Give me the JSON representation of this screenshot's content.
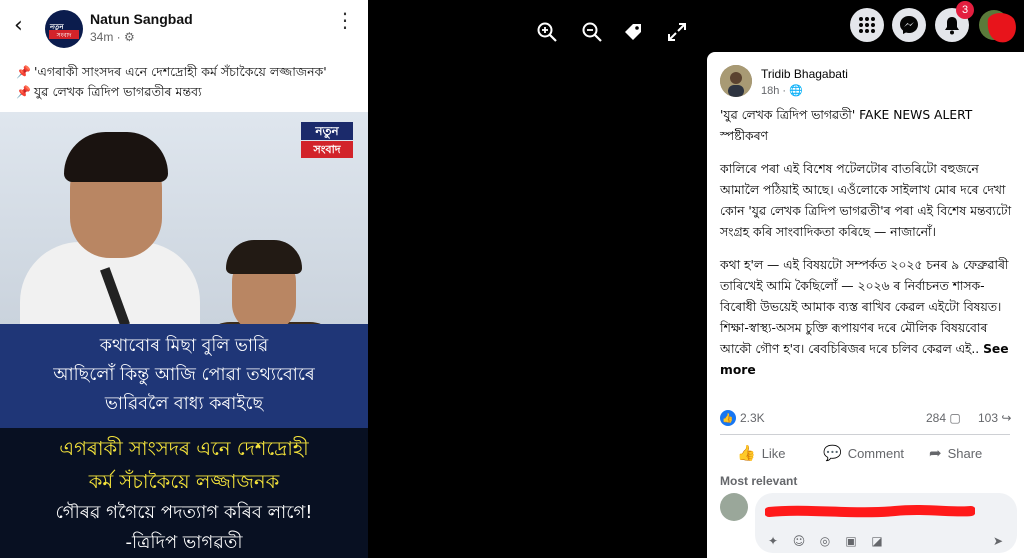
{
  "shared_post": {
    "back_icon": "back-arrow-icon",
    "page_name": "Natun Sangbad",
    "logo_text": "নতুন",
    "logo_sub": "সংবাদ",
    "meta": "34m · ",
    "lines": [
      "'এগৰাকী সাংসদৰ এনে দেশদ্ৰোহী কৰ্ম সঁচাকৈয়ে লজ্জাজনক'",
      "যুৱ লেখক ত্ৰিদিপ ভাগৱতীৰ মন্তব্য"
    ],
    "image": {
      "badge_top": "নতুন",
      "badge_bottom": "সংবাদ",
      "quote_lines": [
        "কথাবোৰ মিছা বুলি ভাৱি",
        "আছিলোঁ কিন্তু আজি পোৱা তথ্যবোৰে",
        "ভাৱিবলৈ বাধ্য কৰাইছে"
      ],
      "headline_lines": [
        "এগৰাকী সাংসদৰ এনে দেশদ্ৰোহী",
        "কৰ্ম সঁচাকৈয়ে লজ্জাজনক"
      ],
      "white_line": "গৌৰৱ গগৈয়ে পদত্যাগ কৰিব লাগে!",
      "author_line": "-ত্ৰিদিপ ভাগৱতী"
    }
  },
  "viewer_toolbar": {
    "icons": [
      "zoom-in-icon",
      "zoom-out-icon",
      "tag-icon",
      "fullscreen-icon"
    ]
  },
  "topbar": {
    "notification_count": "3",
    "icons": [
      "menu-grid-icon",
      "messenger-icon",
      "bell-icon",
      "account-avatar"
    ]
  },
  "post": {
    "author": "Tridib Bhagabati",
    "meta": "18h · ",
    "paragraphs": [
      "'যুৱ লেখক ত্ৰিদিপ ভাগৱতী' FAKE NEWS ALERT স্পষ্টীকৰণ",
      "কালিৰে পৰা এই বিশেষ পটেলটোৰ বাতৰিটো বহুজনে আমালৈ পঠিয়াই আছে। এওঁলোকে সাইলাখ মোৰ দৰে দেখা কোন 'যুৱ লেখক ত্ৰিদিপ ভাগৱতী'ৰ পৰা এই বিশেষ মন্তব্যটো সংগ্ৰহ কৰি সাংবাদিকতা কৰিছে — নাজানোঁ।",
      "কথা হ'ল — এই বিষয়টো সম্পৰ্কত ২০২৫ চনৰ ৯ ফেব্ৰুৱাৰী তাৰিখেই আমি কৈছিলোঁ — ২০২৬ ৰ নিৰ্বাচনত শাসক-বিৰোধী উভয়েই আমাক ব্যস্ত ৰাখিব কেৱল এইটো বিষয়ত। শিক্ষা-স্বাস্থ্য-অসম চুক্তি ৰূপায়ণৰ দৰে মৌলিক বিষয়বোৰ আকৌ গৌণ হ'ব। ৰেবচিৰিজৰ দৰে চলিব কেৱল এই.."
    ],
    "see_more": "See more",
    "reactions": {
      "like_count": "2.3K",
      "comment_count": "284",
      "share_count": "103"
    },
    "actions": {
      "like": "Like",
      "comment": "Comment",
      "share": "Share"
    },
    "most_relevant": "Most relevant"
  }
}
